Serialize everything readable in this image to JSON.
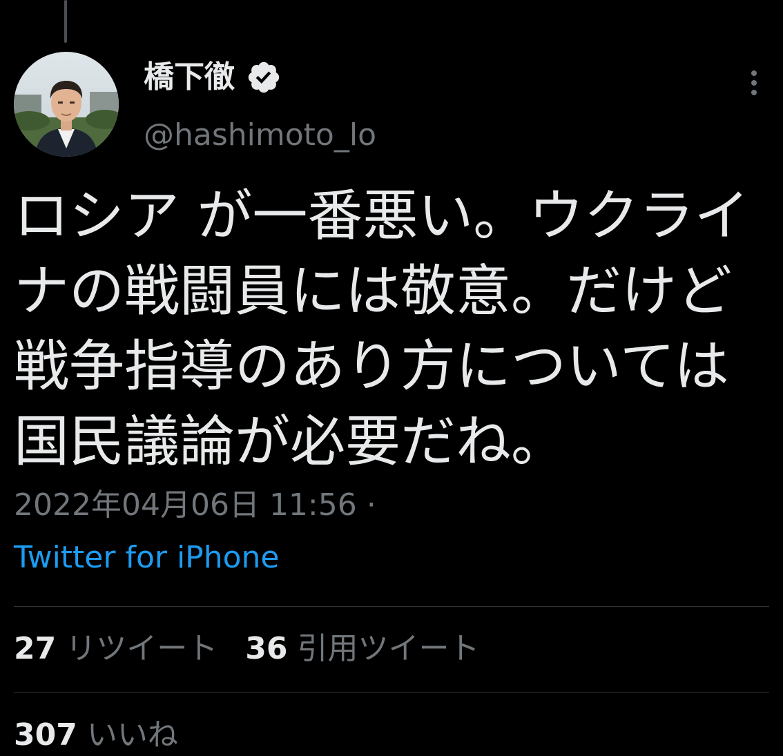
{
  "tweet": {
    "author": {
      "display_name": "橋下徹",
      "handle": "@hashimoto_lo",
      "verified": true
    },
    "text": "ロシア が一番悪い。ウクライナの戦闘員には敬意。だけど戦争指導のあり方については国民議論が必要だね。",
    "timestamp": "2022年04月06日 11:56 ·",
    "source": "Twitter for iPhone",
    "stats": {
      "retweets_count": "27",
      "retweets_label": "リツイート",
      "quotes_count": "36",
      "quotes_label": "引用ツイート",
      "likes_count": "307",
      "likes_label": "いいね"
    }
  },
  "icons": {
    "verified": "verified-badge-icon",
    "more": "more-vertical-icon"
  },
  "colors": {
    "background": "#000000",
    "text_primary": "#e7e9ea",
    "text_secondary": "#71767b",
    "link": "#1d9bf0",
    "divider": "#2f3336"
  }
}
